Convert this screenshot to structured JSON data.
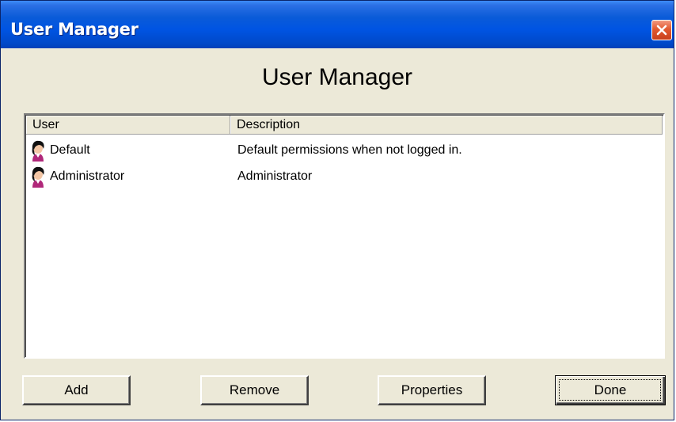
{
  "window": {
    "title": "User Manager"
  },
  "dialog": {
    "heading": "User Manager"
  },
  "list": {
    "columns": [
      "User",
      "Description"
    ],
    "rows": [
      {
        "user": "Default",
        "description": "Default permissions when not logged in.",
        "icon": "user-icon"
      },
      {
        "user": "Administrator",
        "description": "Administrator",
        "icon": "user-icon"
      }
    ]
  },
  "buttons": {
    "add": "Add",
    "remove": "Remove",
    "properties": "Properties",
    "done": "Done"
  },
  "colors": {
    "titlebar": "#0054e3",
    "close_button": "#e2592f",
    "window_background": "#ece9d8",
    "list_background": "#ffffff"
  }
}
